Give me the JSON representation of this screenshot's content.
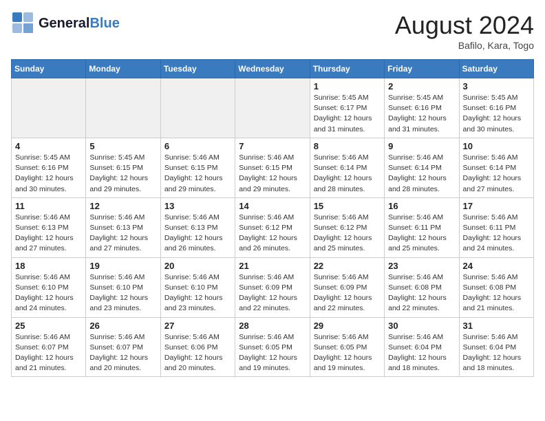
{
  "header": {
    "logo_line1": "General",
    "logo_line2": "Blue",
    "month_year": "August 2024",
    "location": "Bafilo, Kara, Togo"
  },
  "weekdays": [
    "Sunday",
    "Monday",
    "Tuesday",
    "Wednesday",
    "Thursday",
    "Friday",
    "Saturday"
  ],
  "weeks": [
    [
      {
        "day": "",
        "info": ""
      },
      {
        "day": "",
        "info": ""
      },
      {
        "day": "",
        "info": ""
      },
      {
        "day": "",
        "info": ""
      },
      {
        "day": "1",
        "info": "Sunrise: 5:45 AM\nSunset: 6:17 PM\nDaylight: 12 hours\nand 31 minutes."
      },
      {
        "day": "2",
        "info": "Sunrise: 5:45 AM\nSunset: 6:16 PM\nDaylight: 12 hours\nand 31 minutes."
      },
      {
        "day": "3",
        "info": "Sunrise: 5:45 AM\nSunset: 6:16 PM\nDaylight: 12 hours\nand 30 minutes."
      }
    ],
    [
      {
        "day": "4",
        "info": "Sunrise: 5:45 AM\nSunset: 6:16 PM\nDaylight: 12 hours\nand 30 minutes."
      },
      {
        "day": "5",
        "info": "Sunrise: 5:45 AM\nSunset: 6:15 PM\nDaylight: 12 hours\nand 29 minutes."
      },
      {
        "day": "6",
        "info": "Sunrise: 5:46 AM\nSunset: 6:15 PM\nDaylight: 12 hours\nand 29 minutes."
      },
      {
        "day": "7",
        "info": "Sunrise: 5:46 AM\nSunset: 6:15 PM\nDaylight: 12 hours\nand 29 minutes."
      },
      {
        "day": "8",
        "info": "Sunrise: 5:46 AM\nSunset: 6:14 PM\nDaylight: 12 hours\nand 28 minutes."
      },
      {
        "day": "9",
        "info": "Sunrise: 5:46 AM\nSunset: 6:14 PM\nDaylight: 12 hours\nand 28 minutes."
      },
      {
        "day": "10",
        "info": "Sunrise: 5:46 AM\nSunset: 6:14 PM\nDaylight: 12 hours\nand 27 minutes."
      }
    ],
    [
      {
        "day": "11",
        "info": "Sunrise: 5:46 AM\nSunset: 6:13 PM\nDaylight: 12 hours\nand 27 minutes."
      },
      {
        "day": "12",
        "info": "Sunrise: 5:46 AM\nSunset: 6:13 PM\nDaylight: 12 hours\nand 27 minutes."
      },
      {
        "day": "13",
        "info": "Sunrise: 5:46 AM\nSunset: 6:13 PM\nDaylight: 12 hours\nand 26 minutes."
      },
      {
        "day": "14",
        "info": "Sunrise: 5:46 AM\nSunset: 6:12 PM\nDaylight: 12 hours\nand 26 minutes."
      },
      {
        "day": "15",
        "info": "Sunrise: 5:46 AM\nSunset: 6:12 PM\nDaylight: 12 hours\nand 25 minutes."
      },
      {
        "day": "16",
        "info": "Sunrise: 5:46 AM\nSunset: 6:11 PM\nDaylight: 12 hours\nand 25 minutes."
      },
      {
        "day": "17",
        "info": "Sunrise: 5:46 AM\nSunset: 6:11 PM\nDaylight: 12 hours\nand 24 minutes."
      }
    ],
    [
      {
        "day": "18",
        "info": "Sunrise: 5:46 AM\nSunset: 6:10 PM\nDaylight: 12 hours\nand 24 minutes."
      },
      {
        "day": "19",
        "info": "Sunrise: 5:46 AM\nSunset: 6:10 PM\nDaylight: 12 hours\nand 23 minutes."
      },
      {
        "day": "20",
        "info": "Sunrise: 5:46 AM\nSunset: 6:10 PM\nDaylight: 12 hours\nand 23 minutes."
      },
      {
        "day": "21",
        "info": "Sunrise: 5:46 AM\nSunset: 6:09 PM\nDaylight: 12 hours\nand 22 minutes."
      },
      {
        "day": "22",
        "info": "Sunrise: 5:46 AM\nSunset: 6:09 PM\nDaylight: 12 hours\nand 22 minutes."
      },
      {
        "day": "23",
        "info": "Sunrise: 5:46 AM\nSunset: 6:08 PM\nDaylight: 12 hours\nand 22 minutes."
      },
      {
        "day": "24",
        "info": "Sunrise: 5:46 AM\nSunset: 6:08 PM\nDaylight: 12 hours\nand 21 minutes."
      }
    ],
    [
      {
        "day": "25",
        "info": "Sunrise: 5:46 AM\nSunset: 6:07 PM\nDaylight: 12 hours\nand 21 minutes."
      },
      {
        "day": "26",
        "info": "Sunrise: 5:46 AM\nSunset: 6:07 PM\nDaylight: 12 hours\nand 20 minutes."
      },
      {
        "day": "27",
        "info": "Sunrise: 5:46 AM\nSunset: 6:06 PM\nDaylight: 12 hours\nand 20 minutes."
      },
      {
        "day": "28",
        "info": "Sunrise: 5:46 AM\nSunset: 6:05 PM\nDaylight: 12 hours\nand 19 minutes."
      },
      {
        "day": "29",
        "info": "Sunrise: 5:46 AM\nSunset: 6:05 PM\nDaylight: 12 hours\nand 19 minutes."
      },
      {
        "day": "30",
        "info": "Sunrise: 5:46 AM\nSunset: 6:04 PM\nDaylight: 12 hours\nand 18 minutes."
      },
      {
        "day": "31",
        "info": "Sunrise: 5:46 AM\nSunset: 6:04 PM\nDaylight: 12 hours\nand 18 minutes."
      }
    ]
  ]
}
